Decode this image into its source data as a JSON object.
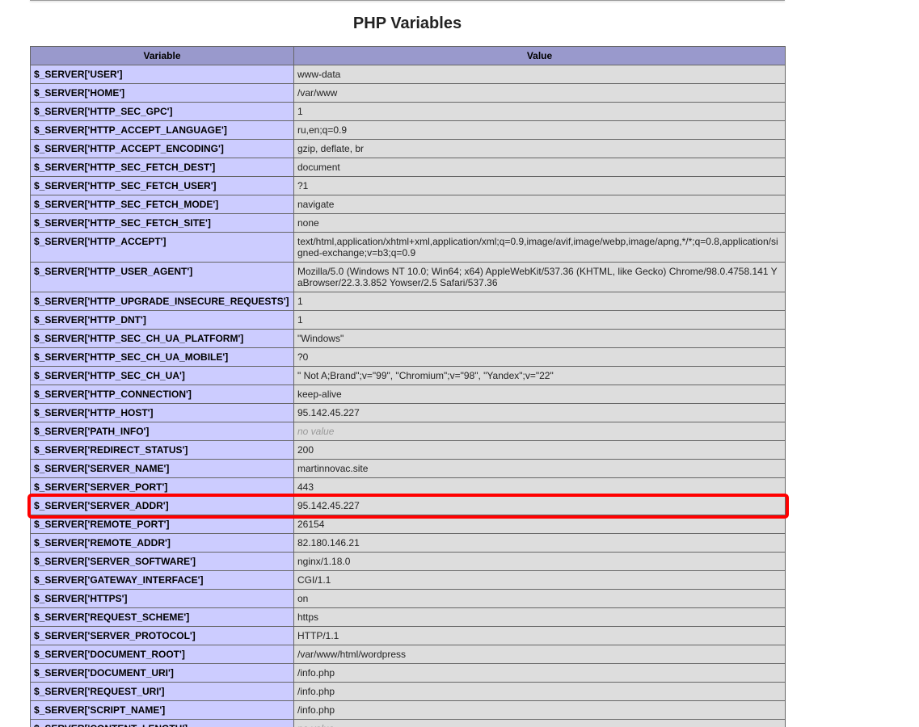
{
  "page_title": "PHP Variables",
  "table": {
    "header_variable": "Variable",
    "header_value": "Value",
    "rows": [
      {
        "name": "$_SERVER['USER']",
        "value": "www-data"
      },
      {
        "name": "$_SERVER['HOME']",
        "value": "/var/www"
      },
      {
        "name": "$_SERVER['HTTP_SEC_GPC']",
        "value": "1"
      },
      {
        "name": "$_SERVER['HTTP_ACCEPT_LANGUAGE']",
        "value": "ru,en;q=0.9"
      },
      {
        "name": "$_SERVER['HTTP_ACCEPT_ENCODING']",
        "value": "gzip, deflate, br"
      },
      {
        "name": "$_SERVER['HTTP_SEC_FETCH_DEST']",
        "value": "document"
      },
      {
        "name": "$_SERVER['HTTP_SEC_FETCH_USER']",
        "value": "?1"
      },
      {
        "name": "$_SERVER['HTTP_SEC_FETCH_MODE']",
        "value": "navigate"
      },
      {
        "name": "$_SERVER['HTTP_SEC_FETCH_SITE']",
        "value": "none"
      },
      {
        "name": "$_SERVER['HTTP_ACCEPT']",
        "value": "text/html,application/xhtml+xml,application/xml;q=0.9,image/avif,image/webp,image/apng,*/*;q=0.8,application/signed-exchange;v=b3;q=0.9"
      },
      {
        "name": "$_SERVER['HTTP_USER_AGENT']",
        "value": "Mozilla/5.0 (Windows NT 10.0; Win64; x64) AppleWebKit/537.36 (KHTML, like Gecko) Chrome/98.0.4758.141 YaBrowser/22.3.3.852 Yowser/2.5 Safari/537.36"
      },
      {
        "name": "$_SERVER['HTTP_UPGRADE_INSECURE_REQUESTS']",
        "value": "1"
      },
      {
        "name": "$_SERVER['HTTP_DNT']",
        "value": "1"
      },
      {
        "name": "$_SERVER['HTTP_SEC_CH_UA_PLATFORM']",
        "value": "\"Windows\""
      },
      {
        "name": "$_SERVER['HTTP_SEC_CH_UA_MOBILE']",
        "value": "?0"
      },
      {
        "name": "$_SERVER['HTTP_SEC_CH_UA']",
        "value": "\" Not A;Brand\";v=\"99\", \"Chromium\";v=\"98\", \"Yandex\";v=\"22\""
      },
      {
        "name": "$_SERVER['HTTP_CONNECTION']",
        "value": "keep-alive"
      },
      {
        "name": "$_SERVER['HTTP_HOST']",
        "value": "95.142.45.227"
      },
      {
        "name": "$_SERVER['PATH_INFO']",
        "value": "no value",
        "novalue": true
      },
      {
        "name": "$_SERVER['REDIRECT_STATUS']",
        "value": "200"
      },
      {
        "name": "$_SERVER['SERVER_NAME']",
        "value": "martinnovac.site"
      },
      {
        "name": "$_SERVER['SERVER_PORT']",
        "value": "443"
      },
      {
        "name": "$_SERVER['SERVER_ADDR']",
        "value": "95.142.45.227",
        "highlighted": true
      },
      {
        "name": "$_SERVER['REMOTE_PORT']",
        "value": "26154"
      },
      {
        "name": "$_SERVER['REMOTE_ADDR']",
        "value": "82.180.146.21"
      },
      {
        "name": "$_SERVER['SERVER_SOFTWARE']",
        "value": "nginx/1.18.0"
      },
      {
        "name": "$_SERVER['GATEWAY_INTERFACE']",
        "value": "CGI/1.1"
      },
      {
        "name": "$_SERVER['HTTPS']",
        "value": "on"
      },
      {
        "name": "$_SERVER['REQUEST_SCHEME']",
        "value": "https"
      },
      {
        "name": "$_SERVER['SERVER_PROTOCOL']",
        "value": "HTTP/1.1"
      },
      {
        "name": "$_SERVER['DOCUMENT_ROOT']",
        "value": "/var/www/html/wordpress"
      },
      {
        "name": "$_SERVER['DOCUMENT_URI']",
        "value": "/info.php"
      },
      {
        "name": "$_SERVER['REQUEST_URI']",
        "value": "/info.php"
      },
      {
        "name": "$_SERVER['SCRIPT_NAME']",
        "value": "/info.php"
      },
      {
        "name": "$_SERVER['CONTENT_LENGTH']",
        "value": "no value",
        "novalue": true
      }
    ]
  },
  "colors": {
    "header_bg": "#9999cc",
    "name_cell_bg": "#ccccff",
    "value_cell_bg": "#dddddd",
    "highlight_border": "#ff0000",
    "no_value_text": "#999999"
  }
}
